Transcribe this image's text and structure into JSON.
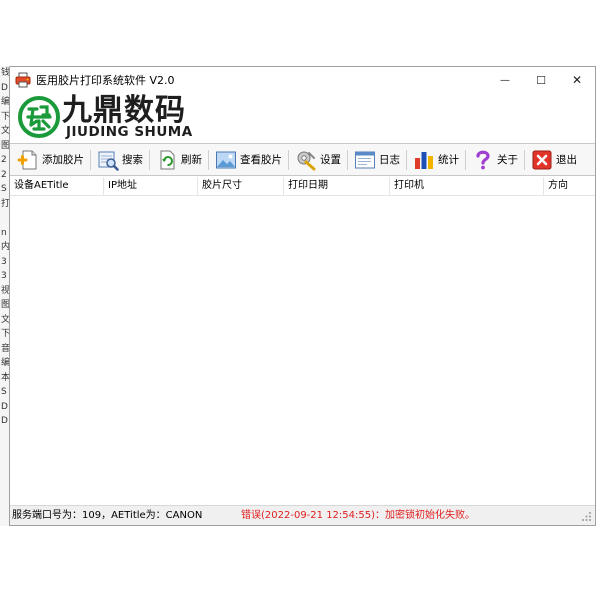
{
  "window": {
    "title": "医用胶片打印系统软件 V2.0",
    "controls": {
      "minimize": "—",
      "maximize": "☐",
      "close": "✕"
    }
  },
  "logo": {
    "cn": "九鼎数码",
    "en": "JIUDING SHUMA",
    "brand_color": "#1a9a3a"
  },
  "toolbar": {
    "add_film": "添加胶片",
    "search": "搜索",
    "refresh": "刷新",
    "view_film": "查看胶片",
    "settings": "设置",
    "log": "日志",
    "stats": "统计",
    "about": "关于",
    "exit": "退出"
  },
  "table": {
    "columns": [
      "设备AETitle",
      "IP地址",
      "胶片尺寸",
      "打印日期",
      "打印机",
      "方向"
    ],
    "rows": []
  },
  "status": {
    "server_info": "服务端口号为：109，AETitle为：CANON",
    "error_message": "错误(2022-09-21 12:54:55)：加密锁初始化失败。",
    "error_color": "#e02020"
  },
  "background_strip": [
    "钱",
    "D",
    "编",
    "下",
    "文",
    "图",
    "2",
    "2",
    "S",
    "打",
    "",
    "n",
    "内",
    "3",
    "3",
    "视",
    "图",
    "文",
    "下",
    "音",
    "编",
    "本",
    "S",
    "D",
    "D"
  ]
}
